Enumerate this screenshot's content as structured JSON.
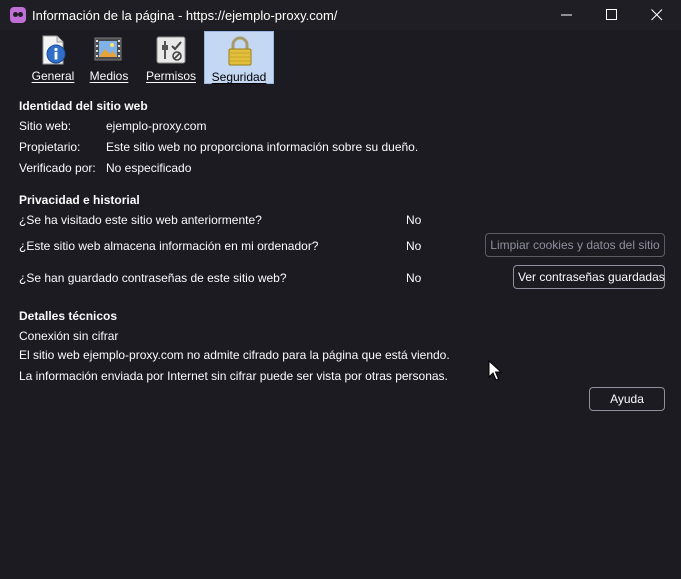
{
  "window": {
    "title": "Información de la página - https://ejemplo-proxy.com/"
  },
  "tabs": [
    {
      "label": "General",
      "icon": "info-icon"
    },
    {
      "label": "Medios",
      "icon": "media-icon"
    },
    {
      "label": "Permisos",
      "icon": "permissions-icon"
    },
    {
      "label": "Seguridad",
      "icon": "lock-icon",
      "selected": true
    }
  ],
  "identity": {
    "heading": "Identidad del sitio web",
    "site_label": "Sitio web:",
    "site_value": "ejemplo-proxy.com",
    "owner_label": "Propietario:",
    "owner_value": "Este sitio web no proporciona información sobre su dueño.",
    "verified_label": "Verificado por:",
    "verified_value": "No especificado"
  },
  "privacy": {
    "heading": "Privacidad e historial",
    "q1": "¿Se ha visitado este sitio web anteriormente?",
    "a1": "No",
    "q2": "¿Este sitio web almacena información en mi ordenador?",
    "a2": "No",
    "clear_button": "Limpiar cookies y datos del sitio",
    "q3": "¿Se han guardado contraseñas de este sitio web?",
    "a3": "No",
    "passwords_button": "Ver contraseñas guardadas"
  },
  "technical": {
    "heading": "Detalles técnicos",
    "line1": "Conexión sin cifrar",
    "line2": "El sitio web ejemplo-proxy.com no admite cifrado para la página que está viendo.",
    "line3": "La información enviada por Internet sin cifrar puede ser vista por otras personas."
  },
  "help_button": "Ayuda",
  "colors": {
    "background": "#1c1b22",
    "text": "#fbfbfe",
    "selected_tab": "#c4d8f4",
    "button_border": "#8f8f9d"
  }
}
